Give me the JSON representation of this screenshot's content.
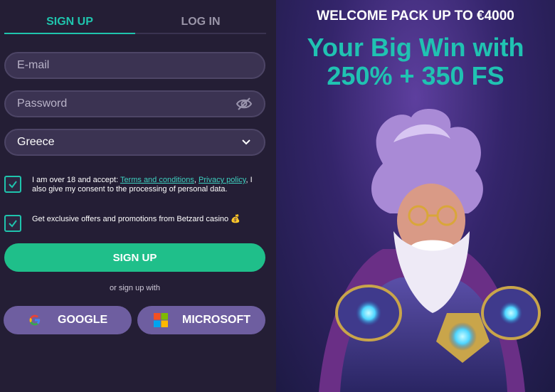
{
  "tabs": {
    "signup": "SIGN UP",
    "login": "LOG IN"
  },
  "form": {
    "email_placeholder": "E-mail",
    "password_placeholder": "Password",
    "country": "Greece"
  },
  "consent": {
    "part1": "I am over 18 and accept: ",
    "terms_link": "Terms and conditions",
    "sep": ", ",
    "privacy_link": "Privacy policy",
    "part2": ", I also give my consent to the processing of personal data."
  },
  "offers": {
    "text": "Get exclusive offers and promotions from Betzard casino 💰"
  },
  "signup_button": "SIGN UP",
  "or_text": "or sign up with",
  "social": {
    "google": "GOOGLE",
    "microsoft": "MICROSOFT"
  },
  "promo": {
    "welcome": "WELCOME PACK UP TO €4000",
    "line1": "Your Big Win with",
    "line2": "250% + 350 FS"
  },
  "colors": {
    "accent": "#1fc4ad",
    "button": "#1fbf8a",
    "social_bg": "#6e5ea0"
  }
}
